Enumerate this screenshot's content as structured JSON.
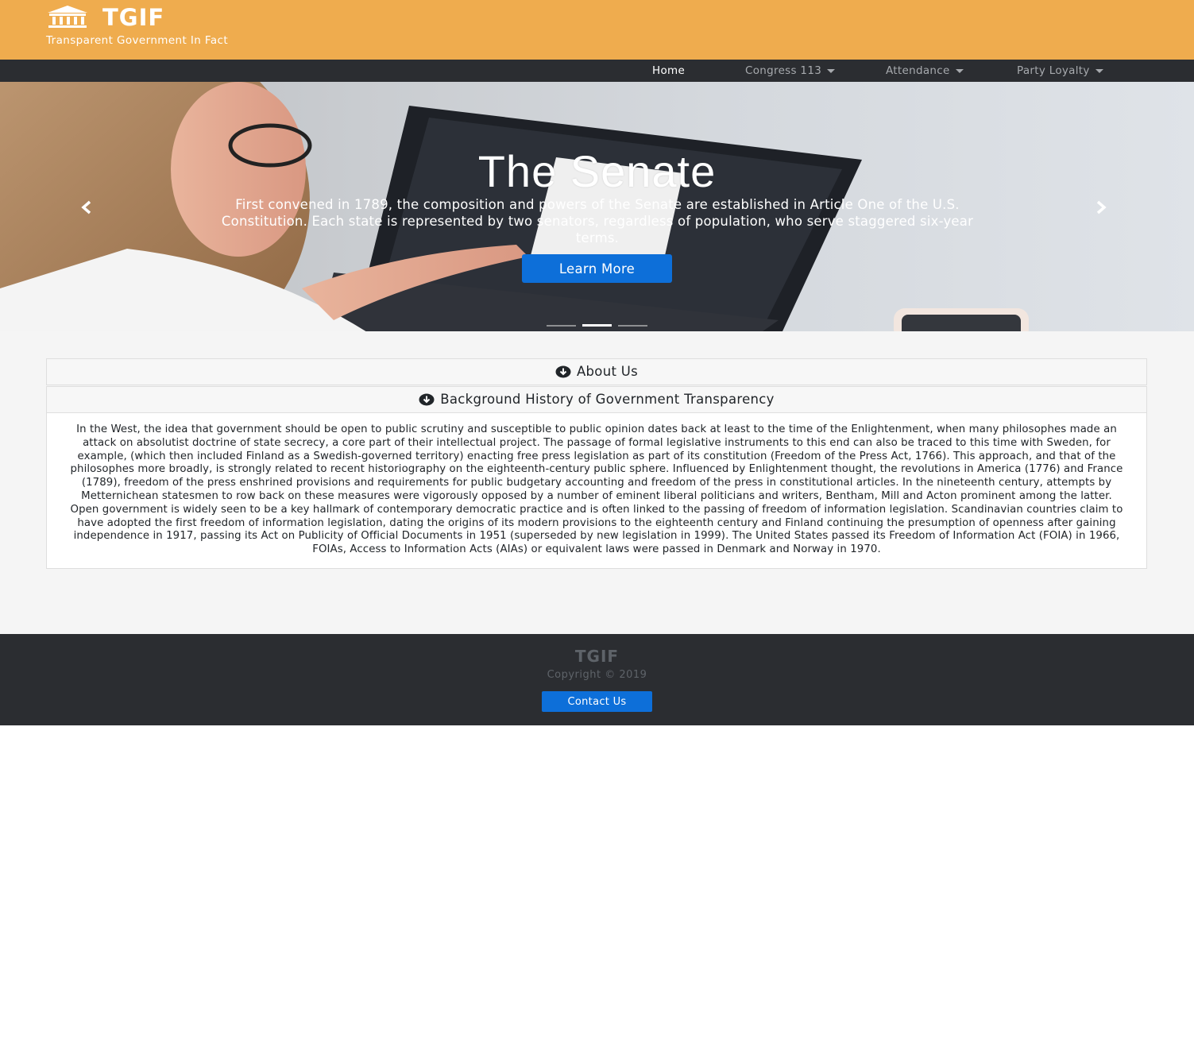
{
  "header": {
    "brand_title": "TGIF",
    "brand_tagline": "Transparent Government In Fact",
    "brand_icon": "bank-building-icon",
    "background_color": "#efac4e"
  },
  "navbar": {
    "items": [
      {
        "label": "Home",
        "active": true,
        "dropdown": false
      },
      {
        "label": "Congress 113",
        "active": false,
        "dropdown": true
      },
      {
        "label": "Attendance",
        "active": false,
        "dropdown": true
      },
      {
        "label": "Party Loyalty",
        "active": false,
        "dropdown": true
      }
    ]
  },
  "hero": {
    "title": "The Senate",
    "text": "First convened in 1789, the composition and powers of the Senate are established in Article One of the U.S. Constitution. Each state is represented by two senators, regardless of population, who serve staggered six-year terms.",
    "button_label": "Learn More",
    "prev_icon": "chevron-left-icon",
    "next_icon": "chevron-right-icon",
    "slide_count": 3,
    "active_slide": 2
  },
  "accordion": {
    "sections": [
      {
        "title": "About Us",
        "icon": "arrow-circle-down-icon",
        "expanded": false
      },
      {
        "title": "Background History of Government Transparency",
        "icon": "arrow-circle-down-icon",
        "expanded": true,
        "body": "In the West, the idea that government should be open to public scrutiny and susceptible to public opinion dates back at least to the time of the Enlightenment, when many philosophes made an attack on absolutist doctrine of state secrecy, a core part of their intellectual project. The passage of formal legislative instruments to this end can also be traced to this time with Sweden, for example, (which then included Finland as a Swedish-governed territory) enacting free press legislation as part of its constitution (Freedom of the Press Act, 1766). This approach, and that of the philosophes more broadly, is strongly related to recent historiography on the eighteenth-century public sphere. Influenced by Enlightenment thought, the revolutions in America (1776) and France (1789), freedom of the press enshrined provisions and requirements for public budgetary accounting and freedom of the press in constitutional articles. In the nineteenth century, attempts by Metternichean statesmen to row back on these measures were vigorously opposed by a number of eminent liberal politicians and writers, Bentham, Mill and Acton prominent among the latter. Open government is widely seen to be a key hallmark of contemporary democratic practice and is often linked to the passing of freedom of information legislation. Scandinavian countries claim to have adopted the first freedom of information legislation, dating the origins of its modern provisions to the eighteenth century and Finland continuing the presumption of openness after gaining independence in 1917, passing its Act on Publicity of Official Documents in 1951 (superseded by new legislation in 1999). The United States passed its Freedom of Information Act (FOIA) in 1966, FOIAs, Access to Information Acts (AIAs) or equivalent laws were passed in Denmark and Norway in 1970."
      }
    ]
  },
  "footer": {
    "brand": "TGIF",
    "copyright": "Copyright © 2019",
    "contact_label": "Contact Us"
  },
  "colors": {
    "header": "#efac4e",
    "navbar": "#2b2d31",
    "primary_button": "#0d6fd9",
    "main_background": "#f5f5f5"
  }
}
